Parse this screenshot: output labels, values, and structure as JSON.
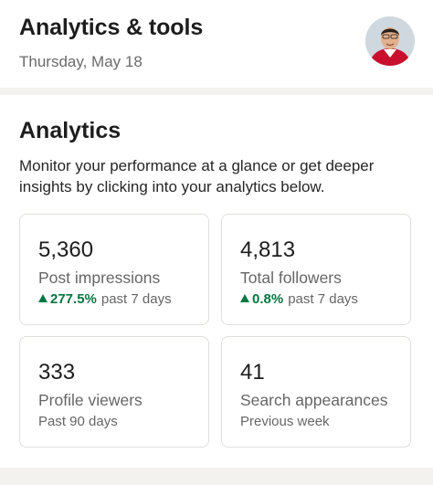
{
  "header": {
    "title": "Analytics & tools",
    "date": "Thursday, May 18"
  },
  "analytics": {
    "title": "Analytics",
    "description": "Monitor your performance at a glance or get deeper insights by clicking into your analytics below.",
    "cards": [
      {
        "value": "5,360",
        "label": "Post impressions",
        "change": "277.5%",
        "period": "past 7 days",
        "trend": "up"
      },
      {
        "value": "4,813",
        "label": "Total followers",
        "change": "0.8%",
        "period": "past 7 days",
        "trend": "up"
      },
      {
        "value": "333",
        "label": "Profile viewers",
        "period": "Past 90 days"
      },
      {
        "value": "41",
        "label": "Search appearances",
        "period": "Previous week"
      }
    ]
  },
  "colors": {
    "positive": "#057642",
    "band": "#f4f2ee",
    "accent_red": "#c8102e"
  },
  "icons": {
    "avatar": "profile-photo",
    "trend": "triangle-up-icon"
  }
}
